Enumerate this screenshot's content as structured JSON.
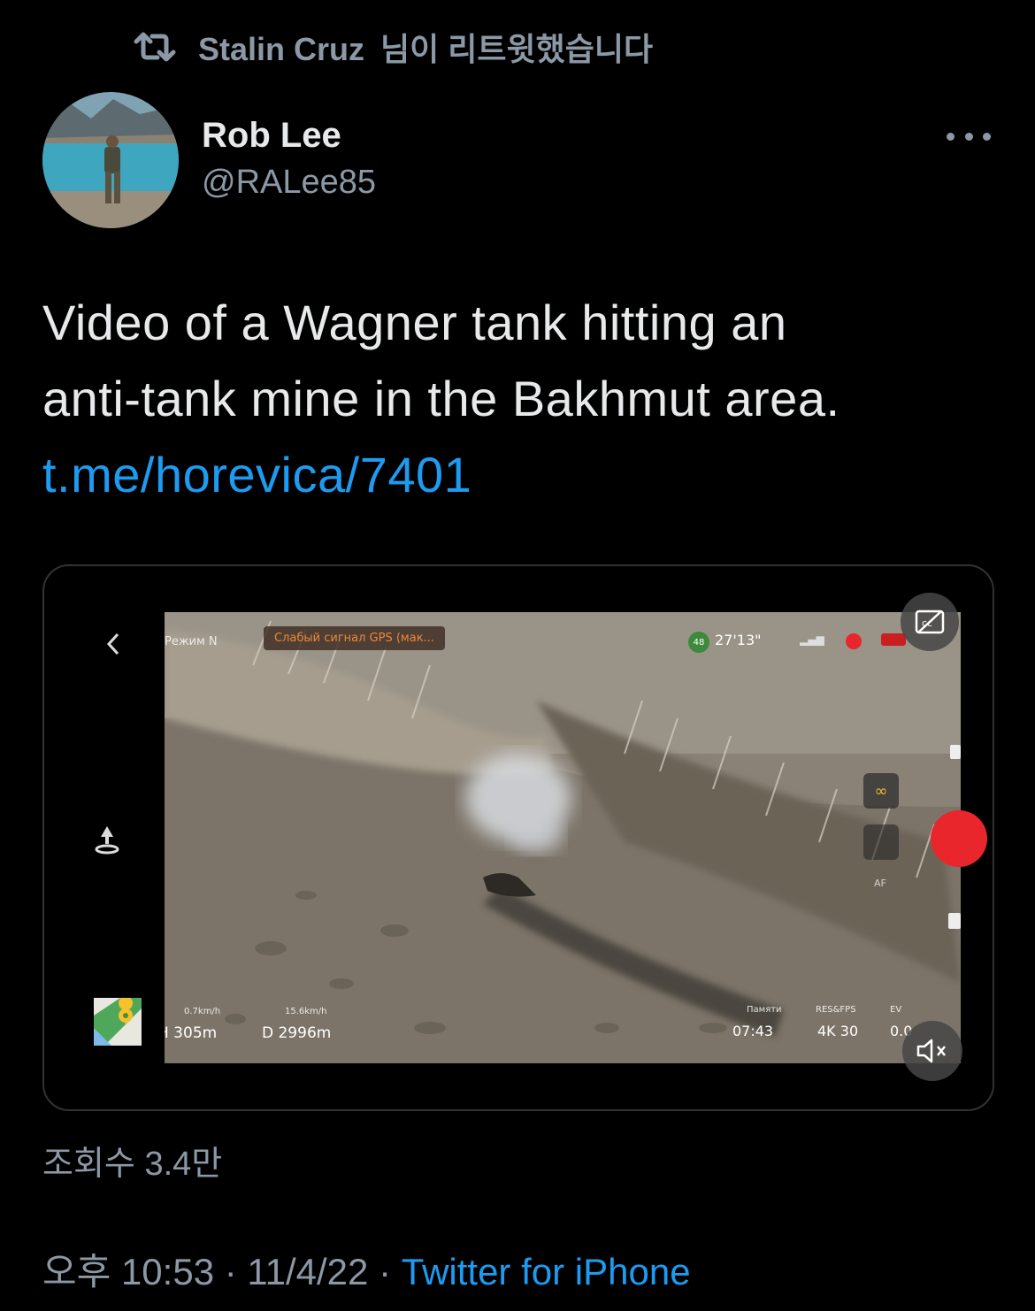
{
  "retweet": {
    "user": "Stalin Cruz",
    "suffix": "님이 리트윗했습니다"
  },
  "author": {
    "name": "Rob Lee",
    "handle": "@RALee85"
  },
  "tweet": {
    "text_line1": "Video of a Wagner tank hitting an",
    "text_line2": "anti-tank mine in the Bakhmut area.",
    "link": "t.me/horevica/7401"
  },
  "video_overlay": {
    "mode": "Режим N",
    "gps_warning": "Слабый сигнал GPS (мак...",
    "battery": "48",
    "flight_time": "27'13\"",
    "speed_h": "0.7km/h",
    "speed_v": "15.6km/h",
    "height": "H 305m",
    "distance": "D 2996m",
    "storage_label": "Памяти",
    "res_label": "RES&FPS",
    "ev_label": "EV",
    "storage": "07:43",
    "res": "4K 30",
    "ev": "0.0",
    "af": "AF"
  },
  "stats": {
    "label": "조회수",
    "value": "3.4만"
  },
  "meta": {
    "time": "오후 10:53",
    "sep1": " · ",
    "date": "11/4/22",
    "sep2": " · ",
    "source": "Twitter for iPhone"
  },
  "colors": {
    "link": "#1d9bf0",
    "secondary": "#8b98a5",
    "record": "#e8262b"
  }
}
